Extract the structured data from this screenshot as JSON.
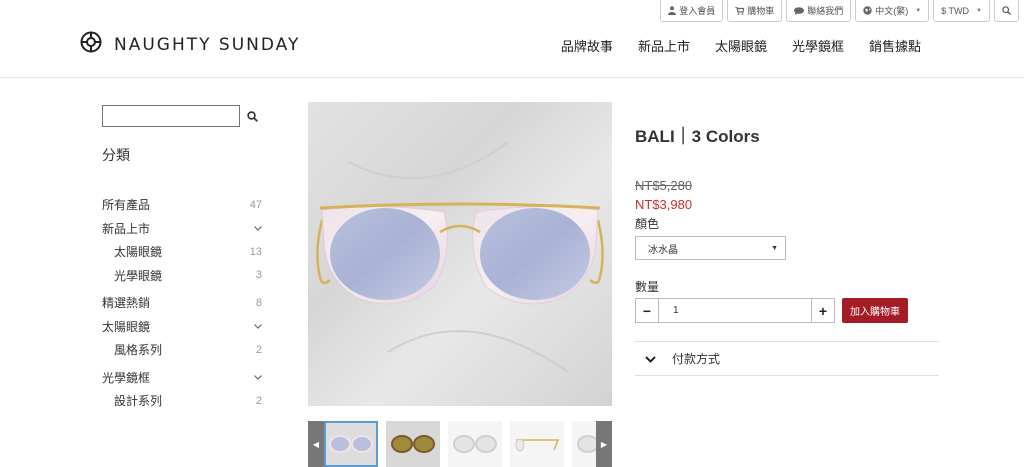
{
  "topbar": {
    "login": "登入會員",
    "cart": "購物車",
    "contact": "聯絡我們",
    "language": "中文(繁)",
    "currency": "$ TWD"
  },
  "header": {
    "logo_text": "NAUGHTY SUNDAY",
    "nav": [
      "品牌故事",
      "新品上市",
      "太陽眼鏡",
      "光學鏡框",
      "銷售據點"
    ]
  },
  "sidebar": {
    "search_value": "",
    "heading": "分類",
    "categories": [
      {
        "label": "所有產品",
        "count": "47"
      },
      {
        "label": "新品上市",
        "chevron": "⌄"
      },
      {
        "label": "太陽眼鏡",
        "count": "13"
      },
      {
        "label": "光學眼鏡",
        "count": "3"
      },
      {
        "label": "精選熱銷",
        "count": "8"
      },
      {
        "label": "太陽眼鏡",
        "chevron": "⌄"
      },
      {
        "label": "風格系列",
        "count": "2"
      },
      {
        "label": "光學鏡框",
        "chevron": "⌄"
      },
      {
        "label": "設計系列",
        "count": "2"
      }
    ]
  },
  "product": {
    "title": "BALI｜3 Colors",
    "price_original": "NT$5,280",
    "price_sale": "NT$3,980",
    "color_label": "顏色",
    "color_selected": "冰水晶",
    "qty_label": "數量",
    "qty_value": "1",
    "minus": "−",
    "plus": "+",
    "add_to_cart": "加入購物車",
    "payment_label": "付款方式"
  },
  "colors": {
    "sale_price": "#c9302c",
    "add_to_cart_bg": "#a41c25",
    "active_thumb_border": "#5a9bd4"
  }
}
